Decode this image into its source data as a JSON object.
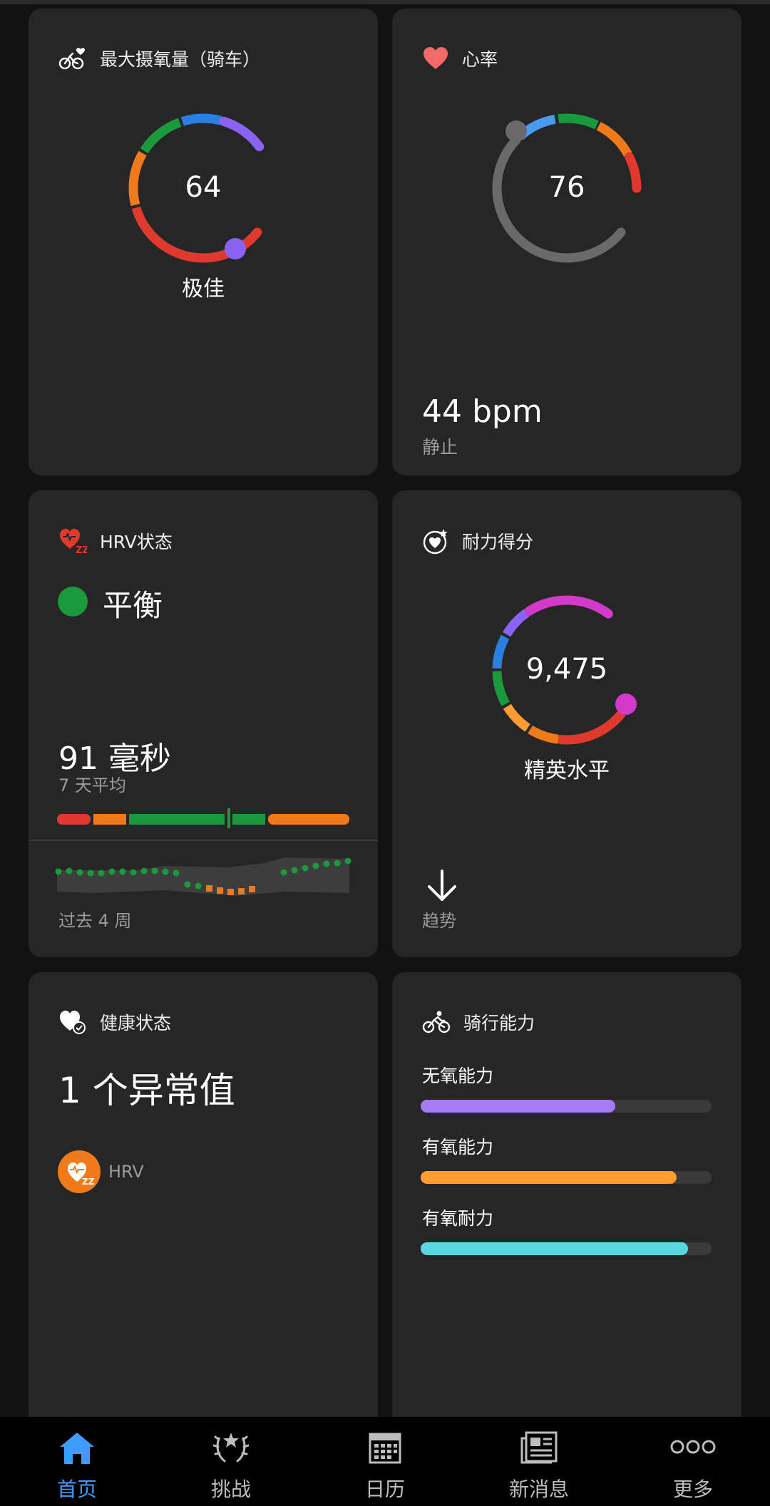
{
  "cards": {
    "vo2": {
      "title": "最大摄氧量（骑车）",
      "value": "64",
      "label": "极佳"
    },
    "hr": {
      "title": "心率",
      "value": "76",
      "resting_value": "44 bpm",
      "resting_label": "静止"
    },
    "hrv": {
      "title": "HRV状态",
      "status": "平衡",
      "value": "91 毫秒",
      "avg_label": "7 天平均",
      "weeks_label": "过去 4 周",
      "status_color": "#1a9a3c"
    },
    "endurance": {
      "title": "耐力得分",
      "value": "9,475",
      "label": "精英水平",
      "trend_label": "趋势"
    },
    "health": {
      "title": "健康状态",
      "outliers": "1 个异常值",
      "item": "HRV"
    },
    "cycling": {
      "title": "骑行能力",
      "bars": [
        {
          "label": "无氧能力",
          "level": 0.67,
          "color": "#a57cf5"
        },
        {
          "label": "有氧能力",
          "level": 0.88,
          "color": "#ff9b33"
        },
        {
          "label": "有氧耐力",
          "level": 0.92,
          "color": "#5ad7e3"
        }
      ]
    }
  },
  "nav": {
    "items": [
      {
        "label": "首页",
        "icon": "home-icon",
        "active": true
      },
      {
        "label": "挑战",
        "icon": "laurel-icon",
        "active": false
      },
      {
        "label": "日历",
        "icon": "calendar-icon",
        "active": false
      },
      {
        "label": "新消息",
        "icon": "newspaper-icon",
        "active": false
      },
      {
        "label": "更多",
        "icon": "more-icon",
        "active": false
      }
    ]
  },
  "colors": {
    "accent": "#3e9bff",
    "card": "#262626",
    "background": "#121212",
    "red": "#e03a2f",
    "orange": "#ef7a1a",
    "green": "#1a9a3c",
    "blue": "#2a7fe0",
    "purple": "#8a63f2",
    "magenta": "#d33ac9"
  }
}
